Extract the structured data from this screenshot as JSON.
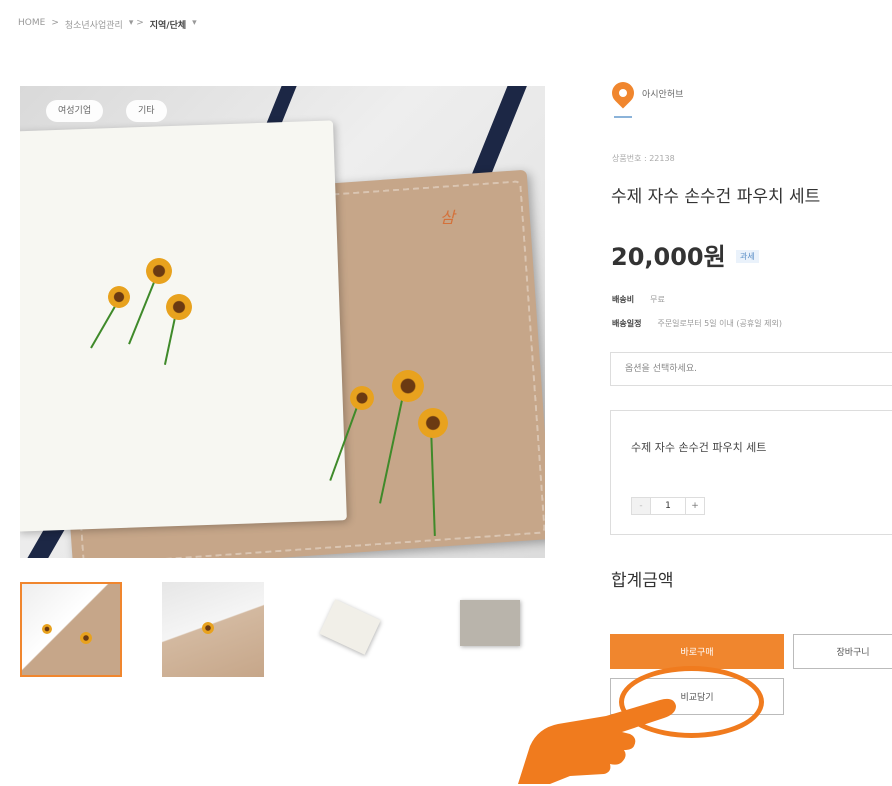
{
  "breadcrumb": {
    "home": "HOME",
    "sep": ">",
    "level1": "청소년사업관리",
    "level1_caret": "▾ >",
    "level2": "지역/단체",
    "level2_caret": "▾"
  },
  "gallery": {
    "tags": [
      "여성기업",
      "기타"
    ],
    "signature": "삼",
    "selected_thumb": 0
  },
  "seller": {
    "name": "아시안허브"
  },
  "product": {
    "code": "상품번호 : 22138",
    "title": "수제 자수 손수건 파우치 세트",
    "price": "20,000원",
    "tax_badge": "과세"
  },
  "shipping": {
    "fee_label": "배송비",
    "fee_value": "무료",
    "schedule_label": "배송일정",
    "schedule_value": "주문일로부터 5일 이내 (공휴일 제외)"
  },
  "option": {
    "placeholder": "옵션을 선택하세요.",
    "selected_name": "수제 자수 손수건 파우치 세트",
    "minus": "-",
    "quantity": "1",
    "plus": "+"
  },
  "total": {
    "label": "합계금액"
  },
  "buttons": {
    "buy": "바로구매",
    "cart": "장바구니",
    "compare": "비교담기"
  },
  "colors": {
    "accent": "#f0862e",
    "highlight": "#f07b1e"
  }
}
